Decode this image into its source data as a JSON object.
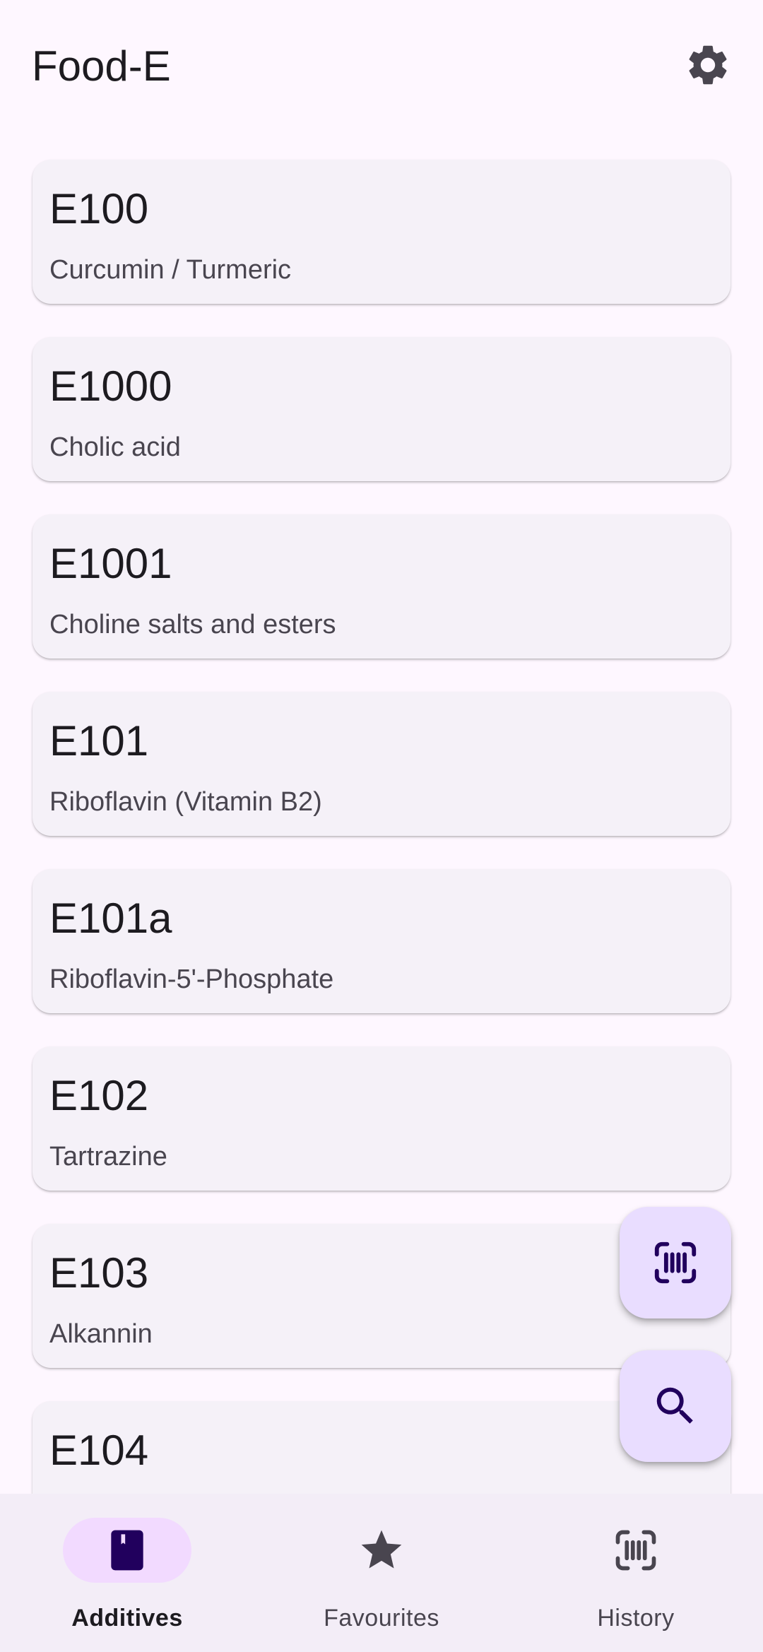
{
  "app": {
    "title": "Food-E"
  },
  "additives": [
    {
      "code": "E100",
      "name": "Curcumin / Turmeric"
    },
    {
      "code": "E1000",
      "name": "Cholic acid"
    },
    {
      "code": "E1001",
      "name": "Choline salts and esters"
    },
    {
      "code": "E101",
      "name": "Riboflavin (Vitamin B2)"
    },
    {
      "code": "E101a",
      "name": "Riboflavin-5'-Phosphate"
    },
    {
      "code": "E102",
      "name": "Tartrazine"
    },
    {
      "code": "E103",
      "name": "Alkannin"
    },
    {
      "code": "E104",
      "name": ""
    }
  ],
  "fabs": {
    "scan_icon": "barcode-scan-icon",
    "search_icon": "search-icon"
  },
  "bottom_nav": {
    "items": [
      {
        "label": "Additives",
        "icon": "book-icon",
        "active": true
      },
      {
        "label": "Favourites",
        "icon": "star-icon",
        "active": false
      },
      {
        "label": "History",
        "icon": "barcode-scan-icon",
        "active": false
      }
    ]
  },
  "colors": {
    "background": "#fef7ff",
    "card": "#f5f1f8",
    "fab": "#e9ddff",
    "nav_background": "#f3edf7",
    "nav_active_indicator": "#f2daff",
    "text_primary": "#1d1b20",
    "text_secondary": "#49454f"
  }
}
